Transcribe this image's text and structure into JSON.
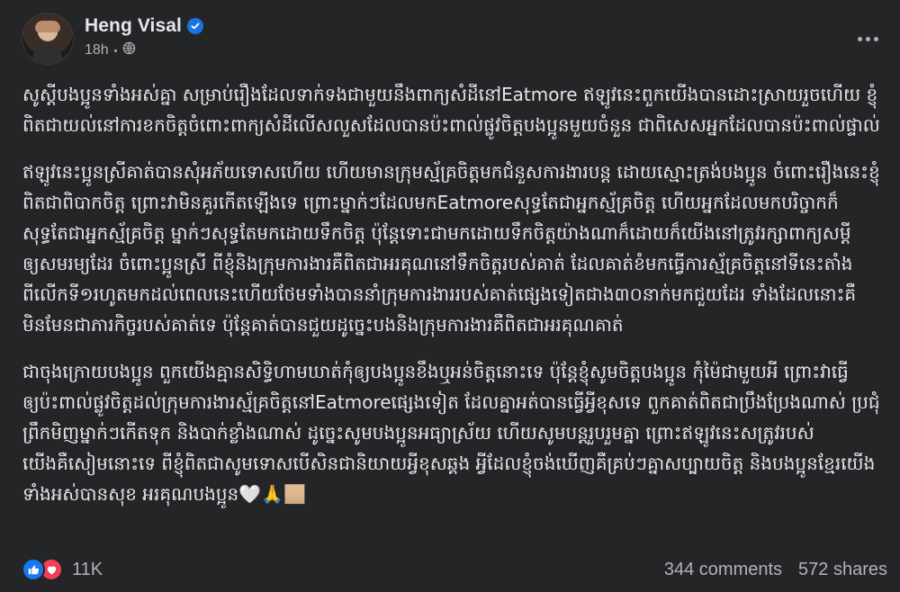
{
  "post": {
    "author": "Heng Visal",
    "time": "18h",
    "icons": {
      "verified": "verified-badge-icon",
      "audience": "globe-icon",
      "more": "more-options-icon",
      "like": "like-reaction-icon",
      "love": "love-reaction-icon"
    },
    "paragraphs": [
      "សូស្តីបងប្អូនទាំងអស់គ្នា សម្រាប់រឿងដែលទាក់ទងជាមួយនឹងពាក្យសំដីនៅEatmore ឥឡូវនេះពួកយើងបានដោះស្រាយរួចហើយ ខ្ញុំពិតជាយល់នៅការខកចិត្តចំពោះពាក្យសំដីលើសលួសដែលបានប៉ះពាល់ផ្លូវចិត្តបងប្អូនមួយចំនួន ជាពិសេសអ្នកដែលបានប៉ះពាល់ផ្ទាល់",
      "ឥឡូវនេះប្អូនស្រីគាត់បានសុំអភ័យទោសហើយ ហើយមានក្រុមស្ម័គ្រចិត្តមកជំនួសការងារបន្ត ដោយស្មោះត្រង់បងប្អូន ចំពោះរឿងនេះខ្ញុំពិតជាពិបាកចិត្ត ព្រោះវាមិនគួរកើតឡើងទេ ព្រោះម្នាក់ៗដែលមកEatmoreសុទ្ធតែជាអ្នកស្ម័គ្រចិត្ត ហើយអ្នកដែលមកបរិច្ចាកក៏សុទ្ធតែជាអ្នកស្ម័គ្រចិត្ត ម្នាក់ៗសុទ្ធតែមកដោយទឹកចិត្ត ប៉ុន្តែទោះជាមកដោយទឹកចិត្តយ៉ាងណាក៏ដោយក៏យើងនៅត្រូវរក្សាពាក្យសម្ដីឲ្យសមរម្យដែរ ចំពោះប្អូនស្រី ពីខ្ញុំនិងក្រុមការងារគឺពិតជាអរគុណនៅទឹកចិត្តរបស់គាត់ ដែលគាត់ខំមកធ្វើការស្ម័គ្រចិត្តនៅទីនេះតាំងពីលើកទី១រហូតមកដល់ពេលនេះហើយថែមទាំងបាននាំក្រុមការងាររបស់គាត់ផ្សេងទៀតជាង៣០នាក់មកជួយដែរ ទាំងដែលនោះគឺមិនមែនជាភារកិច្ចរបស់គាត់ទេ ប៉ុន្តែគាត់បានជួយដូច្នេះបងនិងក្រុមការងារគឺពិតជាអរគុណគាត់",
      "ជាចុងក្រោយបងប្អូន ពួកយើងគ្មានសិទ្ធិហាមឃាត់កុំឲ្យបងប្អូនខឹងឬអន់ចិត្តនោះទេ ប៉ុន្តែខ្ញុំសូមចិត្តបងប្អូន កុំម៉ៃជាមួយអី ព្រោះវាធ្វើឲ្យប៉ះពាល់ផ្លូវចិត្តដល់ក្រុមការងារស្ម័គ្រចិត្តនៅEatmoreផ្សេងទៀត ដែលគ្នាអត់បានធ្វើអ្វីខុសទេ ពួកគាត់ពិតជាប្រឹងប្រែងណាស់ ប្រជុំព្រឹកមិញម្នាក់ៗកើតទុក និងបាក់ខ្លាំងណាស់ ដូច្នេះសូមបងប្អូនអធ្យាស្រ័យ ហើយសូមបន្តរួបរួមគ្នា ព្រោះឥឡូវនេះសត្រូវរបស់យើងគឺសៀមនោះទេ ពីខ្ញុំពិតជាសូមទោសបើសិនជានិយាយអ្វីខុសឆ្គង អ្វីដែលខ្ញុំចង់ឃើញគឺគ្រប់ៗគ្នាសប្បាយចិត្ត និងបងប្អូនខ្មែរយើងទាំងអស់បានសុខ អរគុណបងប្អូន🤍🙏🏼"
    ],
    "reactions_count": "11K",
    "comments": "344 comments",
    "shares": "572 shares"
  }
}
